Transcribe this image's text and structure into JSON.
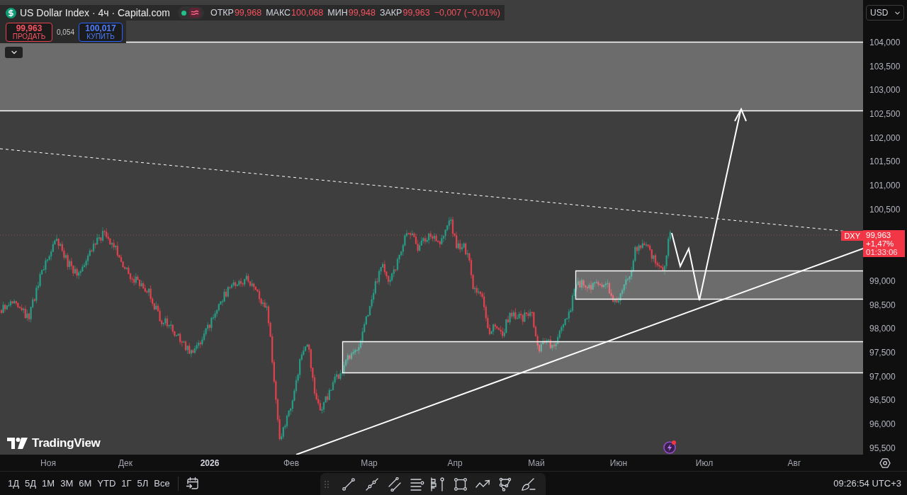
{
  "legend": {
    "title": "US Dollar Index · 4ч · Capital.com",
    "values": [
      {
        "label": "ОТКР",
        "value": "99,968"
      },
      {
        "label": "МАКС",
        "value": "100,068"
      },
      {
        "label": "МИН",
        "value": "99,948"
      },
      {
        "label": "ЗАКР",
        "value": "99,963"
      }
    ],
    "change": "−0,007 (−0,01%)"
  },
  "trade": {
    "sell": {
      "price": "99,963",
      "label": "ПРОДАТЬ"
    },
    "spread": "0,054",
    "buy": {
      "price": "100,017",
      "label": "КУПИТЬ"
    }
  },
  "currency": "USD",
  "price_axis": {
    "upper_ticks": [
      "104,000",
      "103,500",
      "103,000",
      "102,500",
      "102,000",
      "101,500",
      "101,000",
      "100,500"
    ],
    "lower_ticks": [
      "99,000",
      "98,500",
      "98,000",
      "97,500",
      "97,000",
      "96,500",
      "96,000",
      "95,500"
    ]
  },
  "last_price": {
    "symbol": "DXY",
    "price": "99,963",
    "change": "+1,47%",
    "countdown": "01:33:06"
  },
  "time_axis": [
    {
      "label": "Ноя",
      "kind": "month"
    },
    {
      "label": "Дек",
      "kind": "month"
    },
    {
      "label": "2026",
      "kind": "year"
    },
    {
      "label": "Фев",
      "kind": "month"
    },
    {
      "label": "Мар",
      "kind": "month"
    },
    {
      "label": "Апр",
      "kind": "month"
    },
    {
      "label": "Май",
      "kind": "month"
    },
    {
      "label": "Июн",
      "kind": "month"
    },
    {
      "label": "Июл",
      "kind": "month"
    },
    {
      "label": "Авг",
      "kind": "month"
    }
  ],
  "logo": "TradingView",
  "range_buttons": [
    "1Д",
    "5Д",
    "1М",
    "3М",
    "6М",
    "YTD",
    "1Г",
    "5Л",
    "Все"
  ],
  "clock": "09:26:54 UTC+3"
}
